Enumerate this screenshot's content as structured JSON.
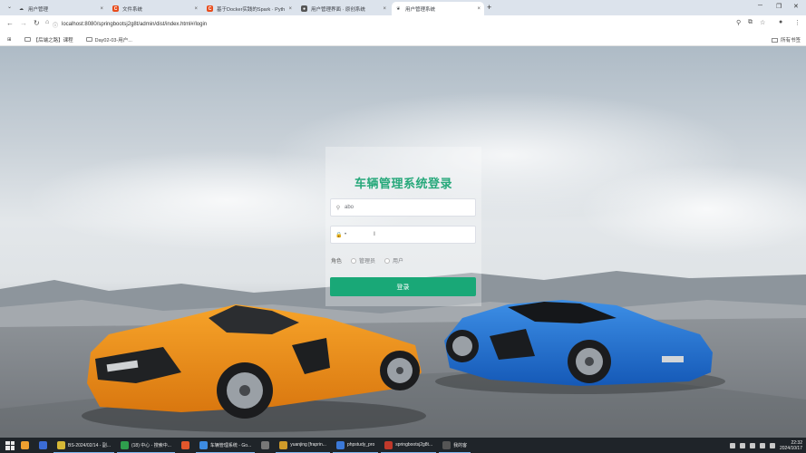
{
  "browser": {
    "tabs": [
      {
        "title": "用户管理",
        "favicon": "cloud-icon",
        "color": "#3c4043",
        "active": false
      },
      {
        "title": "文件系统",
        "favicon": "csdn-icon",
        "color": "#e84c1c",
        "active": false
      },
      {
        "title": "基于Docker实践的Spark · Pyth",
        "favicon": "csdn-icon",
        "color": "#e84c1c",
        "active": false
      },
      {
        "title": "用户管理界面 · 原创系统",
        "favicon": "github-icon",
        "color": "#3c4043",
        "active": false
      },
      {
        "title": "用户管理系统",
        "favicon": "leaf-icon",
        "color": "#3c4043",
        "active": true
      }
    ],
    "new_tab_label": "+",
    "url": "localhost:8080/springbootsj2g8t/admin/dist/index.html#/login",
    "bookmarks": [
      {
        "label": "【后端之路】课程"
      },
      {
        "label": "Day02-03-用户..."
      }
    ],
    "bookmarks_right": "所有书签"
  },
  "login": {
    "title": "车辆管理系统登录",
    "username_icon": "user-icon",
    "username_value": "abo",
    "password_icon": "lock-icon",
    "password_value": "•",
    "role_label": "角色",
    "role_options": [
      {
        "label": "管理员"
      },
      {
        "label": "用户"
      }
    ],
    "submit_label": "登录"
  },
  "taskbar": {
    "apps": [
      {
        "label": "",
        "color": "#f0a030"
      },
      {
        "label": "",
        "color": "#3b6cd6"
      },
      {
        "label": "BS-2024/02/14 - 副...",
        "color": "#d6b836"
      },
      {
        "label": "(18) 中心 - 搜索中...",
        "color": "#2f9e4d"
      },
      {
        "label": "",
        "color": "#e2572c"
      },
      {
        "label": "车辆管理系统 - Go...",
        "color": "#3d8be0"
      },
      {
        "label": "",
        "color": "#777777"
      },
      {
        "label": "yuanjing [fraprin...",
        "color": "#cf9b2a"
      },
      {
        "label": "phpstudy_pro",
        "color": "#3b79d8"
      },
      {
        "label": "springbootsj2g8t...",
        "color": "#c0392b"
      },
      {
        "label": "我的客",
        "color": "#555555"
      }
    ],
    "time": "22:32",
    "date": "2024/10/17"
  }
}
